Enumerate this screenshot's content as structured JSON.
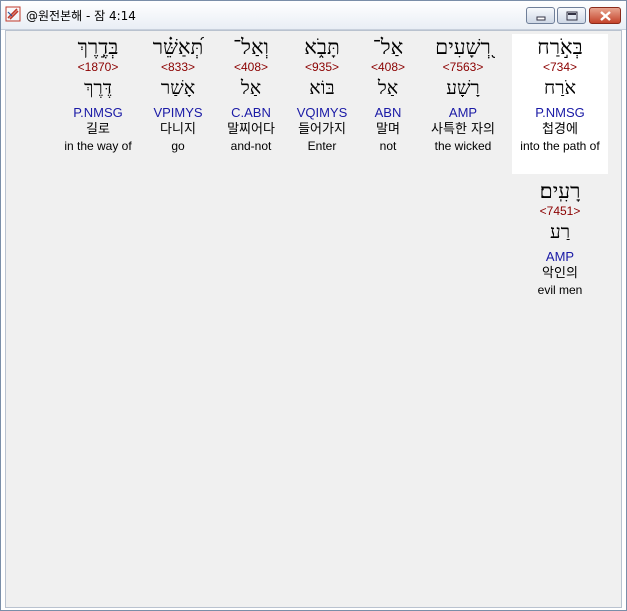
{
  "window": {
    "title": "@원전본해 - 잠 4:14",
    "icon": "app-cross-icon",
    "buttons": {
      "minimize": "minimize-icon",
      "maximize": "maximize-icon",
      "close": "close-icon"
    }
  },
  "words": [
    {
      "hebrew": "בְּאֹ֣רַח",
      "strong": "<734>",
      "lemma": "אֹרַח",
      "parse": "P.NMSG",
      "korean": "첩경에",
      "english": "into the path of",
      "selected": true
    },
    {
      "hebrew": "רְ֭שָׁעִים",
      "strong": "<7563>",
      "lemma": "רָשָׁע",
      "parse": "AMP",
      "korean": "사특한 자의",
      "english": "the wicked"
    },
    {
      "hebrew": "אַל־",
      "strong": "<408>",
      "lemma": "אַל",
      "parse": "ABN",
      "korean": "말며",
      "english": "not"
    },
    {
      "hebrew": "תָּבֹ֑א",
      "strong": "<935>",
      "lemma": "בּוֹא",
      "parse": "VQIMYS",
      "korean": "들어가지",
      "english": "Enter"
    },
    {
      "hebrew": "וְאַל־",
      "strong": "<408>",
      "lemma": "אַל",
      "parse": "C.ABN",
      "korean": "말찌어다",
      "english": "and-not"
    },
    {
      "hebrew": "תְּ֝אַשֵּׁ֗ר",
      "strong": "<833>",
      "lemma": "אָשַׁר",
      "parse": "VPIMYS",
      "korean": "다니지",
      "english": "go"
    },
    {
      "hebrew": "בְּדֶ֣רֶךְ",
      "strong": "<1870>",
      "lemma": "דֶּרֶךְ",
      "parse": "P.NMSG",
      "korean": "길로",
      "english": "in the way of"
    },
    {
      "hebrew": "רָעִֽים׃",
      "strong": "<7451>",
      "lemma": "רַע",
      "parse": "AMP",
      "korean": "악인의",
      "english": "evil men"
    }
  ]
}
